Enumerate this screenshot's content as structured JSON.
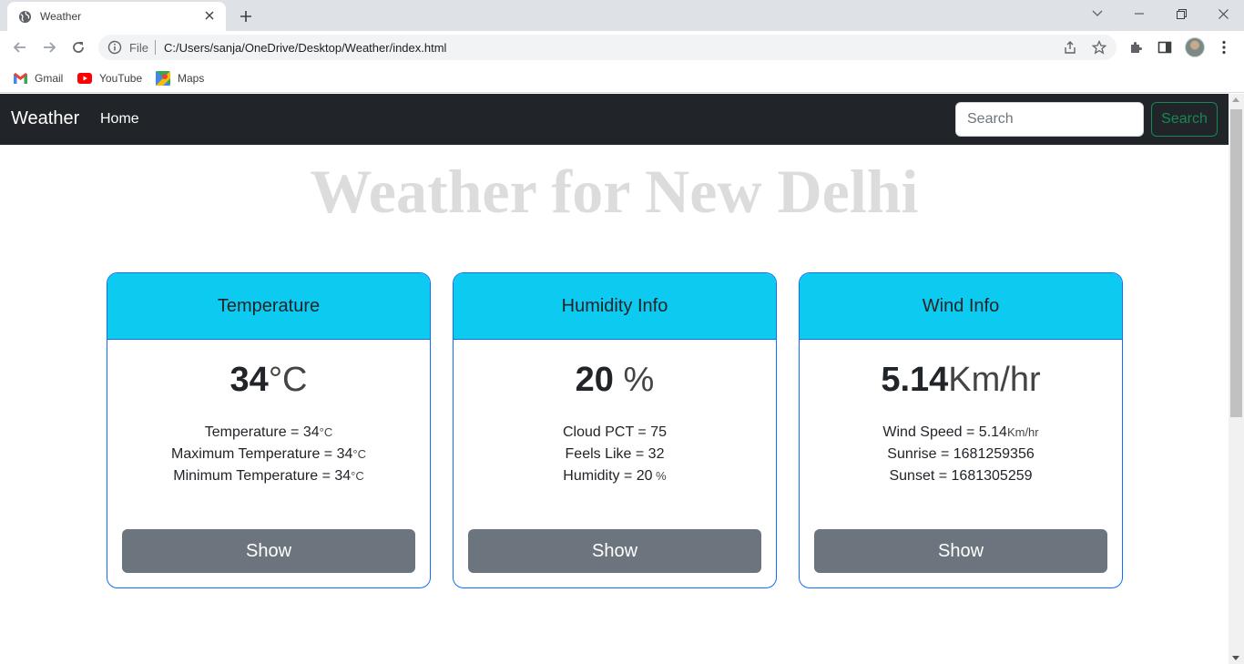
{
  "browser": {
    "tab_title": "Weather",
    "address_prefix": "File",
    "url": "C:/Users/sanja/OneDrive/Desktop/Weather/index.html",
    "bookmarks": [
      {
        "label": "Gmail",
        "icon": "gmail-icon"
      },
      {
        "label": "YouTube",
        "icon": "youtube-icon"
      },
      {
        "label": "Maps",
        "icon": "maps-icon"
      }
    ]
  },
  "navbar": {
    "brand": "Weather",
    "links": [
      "Home"
    ],
    "search_placeholder": "Search",
    "search_button": "Search"
  },
  "page": {
    "title": "Weather for New Delhi"
  },
  "cards": [
    {
      "header": "Temperature",
      "big_value": "34",
      "big_unit": "°C",
      "lines": [
        {
          "text": "Temperature = 34",
          "unit": "°C"
        },
        {
          "text": "Maximum Temperature = 34",
          "unit": "°C"
        },
        {
          "text": "Minimum Temperature = 34",
          "unit": "°C"
        }
      ],
      "button": "Show"
    },
    {
      "header": "Humidity Info",
      "big_value": "20",
      "big_unit": " %",
      "lines": [
        {
          "text": "Cloud PCT = 75",
          "unit": ""
        },
        {
          "text": "Feels Like = 32",
          "unit": ""
        },
        {
          "text": "Humidity = 20",
          "unit": " %"
        }
      ],
      "button": "Show"
    },
    {
      "header": "Wind Info",
      "big_value": "5.14",
      "big_unit": "Km/hr",
      "lines": [
        {
          "text": "Wind Speed = 5.14",
          "unit": "Km/hr"
        },
        {
          "text": "Sunrise = 1681259356",
          "unit": ""
        },
        {
          "text": "Sunset = 1681305259",
          "unit": ""
        }
      ],
      "button": "Show"
    }
  ],
  "colors": {
    "navbar_bg": "#212529",
    "card_header_bg": "#0dcaf0",
    "card_border": "#0d6efd",
    "show_button_bg": "#6c757d",
    "search_button": "#198754",
    "title_text": "#dcdcdc"
  }
}
